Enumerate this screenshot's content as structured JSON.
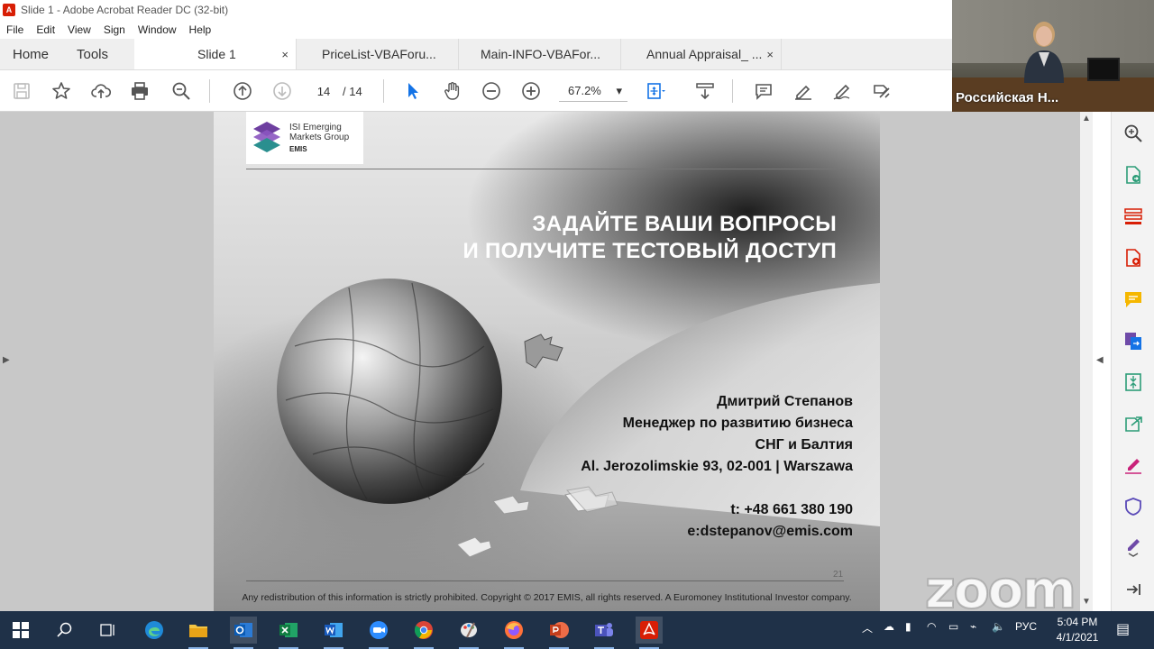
{
  "window": {
    "title": "Slide 1 - Adobe Acrobat Reader DC (32-bit)"
  },
  "menu": [
    "File",
    "Edit",
    "View",
    "Sign",
    "Window",
    "Help"
  ],
  "nav_tabs": {
    "home": "Home",
    "tools": "Tools"
  },
  "doc_tabs": [
    {
      "label": "Slide 1",
      "active": true,
      "close": "×"
    },
    {
      "label": "PriceList-VBAForu...",
      "active": false
    },
    {
      "label": "Main-INFO-VBAFor...",
      "active": false
    },
    {
      "label": "Annual Appraisal_ ...",
      "active": false,
      "close": "×"
    }
  ],
  "toolbar": {
    "page_current": "14",
    "page_total": "/  14",
    "zoom": "67.2%",
    "zoom_caret": "▾"
  },
  "slide": {
    "logo": {
      "line1": "ISI Emerging",
      "line2": "Markets Group",
      "line3": "EMIS"
    },
    "headline": {
      "line1": "ЗАДАЙТЕ ВАШИ ВОПРОСЫ",
      "line2": "И ПОЛУЧИТЕ ТЕСТОВЫЙ ДОСТУП"
    },
    "contact": {
      "name": "Дмитрий Степанов",
      "role": "Менеджер по развитию бизнеса",
      "region": "СНГ и Балтия",
      "address": "Al. Jerozolimskie 93, 02-001  |  Warszawa",
      "phone": "t: +48 661 380 190",
      "email": "e:dstepanov@emis.com"
    },
    "page_number": "21",
    "footer": "Any redistribution of this information is strictly prohibited. Copyright © 2017 EMIS, all rights reserved. A Euromoney Institutional Investor company."
  },
  "video": {
    "participant_name": "Российская Н..."
  },
  "watermark": "zoom",
  "taskbar": {
    "language": "РУС",
    "time": "5:04 PM",
    "date": "4/1/2021"
  },
  "colors": {
    "acrobat_red": "#d81e05",
    "tool_blue": "#1473e6",
    "taskbar_bg": "#1f3148",
    "side_pane_green": "#2d9d78",
    "side_pane_purple": "#6e4aa8"
  }
}
